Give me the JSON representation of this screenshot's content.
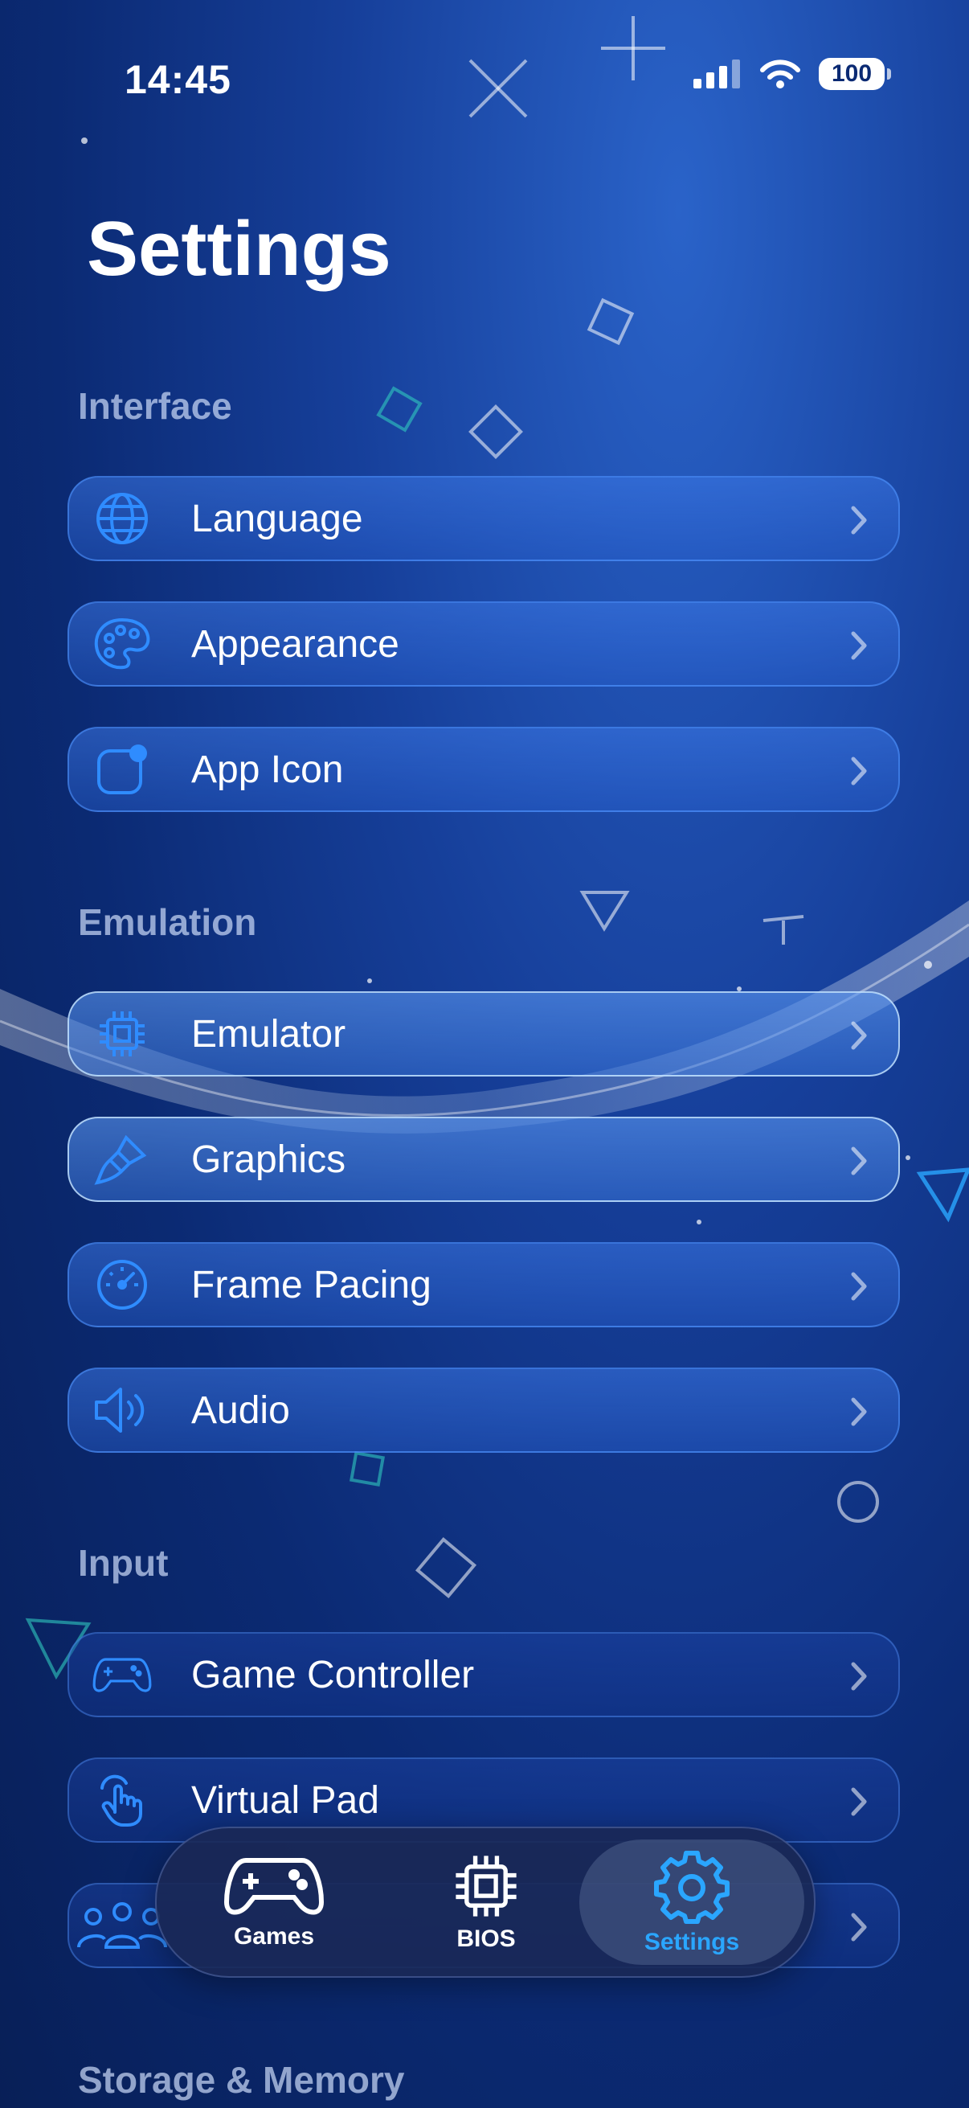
{
  "status_bar": {
    "time": "14:45",
    "battery": "100"
  },
  "title": "Settings",
  "sections": [
    {
      "header": "Interface",
      "items": [
        {
          "label": "Language",
          "icon": "globe-icon"
        },
        {
          "label": "Appearance",
          "icon": "palette-icon"
        },
        {
          "label": "App Icon",
          "icon": "app-icon-badge-icon"
        }
      ]
    },
    {
      "header": "Emulation",
      "items": [
        {
          "label": "Emulator",
          "icon": "chip-icon"
        },
        {
          "label": "Graphics",
          "icon": "paintbrush-icon"
        },
        {
          "label": "Frame Pacing",
          "icon": "gauge-icon"
        },
        {
          "label": "Audio",
          "icon": "speaker-icon"
        }
      ]
    },
    {
      "header": "Input",
      "items": [
        {
          "label": "Game Controller",
          "icon": "gamepad-icon"
        },
        {
          "label": "Virtual Pad",
          "icon": "hand-tap-icon"
        },
        {
          "label": "",
          "icon": "people-icon"
        }
      ]
    },
    {
      "header": "Storage & Memory",
      "items": []
    }
  ],
  "tabbar": {
    "tabs": [
      {
        "label": "Games",
        "icon": "gamepad-icon"
      },
      {
        "label": "BIOS",
        "icon": "chip-icon"
      },
      {
        "label": "Settings",
        "icon": "gear-icon"
      }
    ],
    "selected": "Settings"
  },
  "colors": {
    "accent": "#2aa6ff",
    "icon_blue": "#2f8cff"
  }
}
